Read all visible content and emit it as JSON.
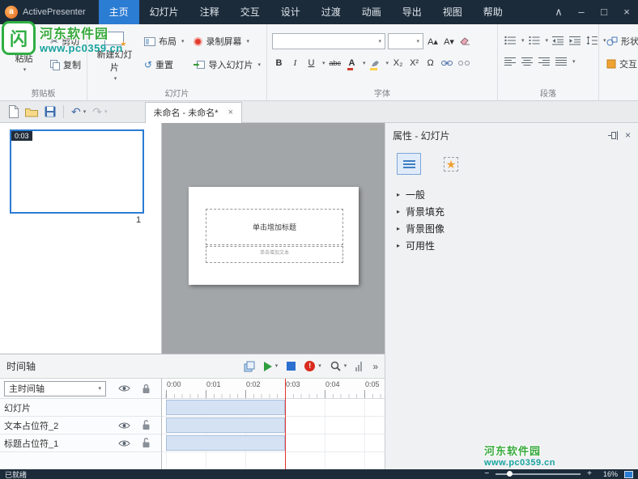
{
  "titlebar": {
    "app_name": "ActivePresenter",
    "menus": [
      "主页",
      "幻灯片",
      "注释",
      "交互",
      "设计",
      "过渡",
      "动画",
      "导出",
      "视图",
      "帮助"
    ]
  },
  "icons": {
    "dropdown": "▾",
    "collapse": "∧",
    "minimize": "–",
    "maximize": "□",
    "close": "×",
    "scissors": "✂",
    "undo": "↶",
    "redo": "↷",
    "reset_glyph": "↺",
    "section_arrow": "▸",
    "more": "»",
    "star": "★",
    "alert": "!",
    "grow_font": "A▴",
    "shrink_font": "A▾",
    "tab_close": "×",
    "minus": "−",
    "plus": "+"
  },
  "ribbon": {
    "clipboard": {
      "label": "剪贴板",
      "paste": "粘贴",
      "cut": "剪切",
      "copy": "复制"
    },
    "slides": {
      "label": "幻灯片",
      "new_slide": "新建幻灯片",
      "layout": "布局",
      "reset": "重置",
      "record_screen": "录制屏幕",
      "import_slides": "导入幻灯片"
    },
    "font": {
      "label": "字体",
      "family_value": "",
      "size_value": "",
      "bold": "B",
      "italic": "I",
      "underline": "U",
      "strike": "abc",
      "color": "A",
      "subscript": "X₂",
      "superscript": "X²",
      "symbol": "Ω"
    },
    "paragraph": {
      "label": "段落"
    },
    "shapes_label": "形状",
    "interactions_label": "交互"
  },
  "document_tab": {
    "title": "未命名 - 未命名*"
  },
  "thumbnail": {
    "time": "0:03",
    "number": "1"
  },
  "canvas": {
    "title_placeholder": "单击增加标题",
    "text_placeholder": "单击增加文本"
  },
  "properties": {
    "title": "属性 - 幻灯片",
    "sections": [
      "一般",
      "背景填充",
      "背景图像",
      "可用性"
    ]
  },
  "timeline": {
    "title": "时间轴",
    "track_selector": "主时间轴",
    "rows": [
      {
        "label": "幻灯片"
      },
      {
        "label": "文本占位符_2"
      },
      {
        "label": "标题占位符_1"
      }
    ],
    "ruler": [
      "0:00",
      "0:01",
      "0:02",
      "0:03",
      "0:04",
      "0:05"
    ],
    "clips": [
      {
        "row": "幻灯片",
        "start": "0:00",
        "end": "0:03"
      },
      {
        "row": "文本占位符_2",
        "start": "0:00",
        "end": "0:03"
      },
      {
        "row": "标题占位符_1",
        "start": "0:00",
        "end": "0:03"
      }
    ],
    "playhead": "0:03"
  },
  "statusbar": {
    "status": "已就绪",
    "zoom": "16%"
  },
  "watermark": {
    "site": "河东软件园",
    "url": "www.pc0359.cn"
  }
}
